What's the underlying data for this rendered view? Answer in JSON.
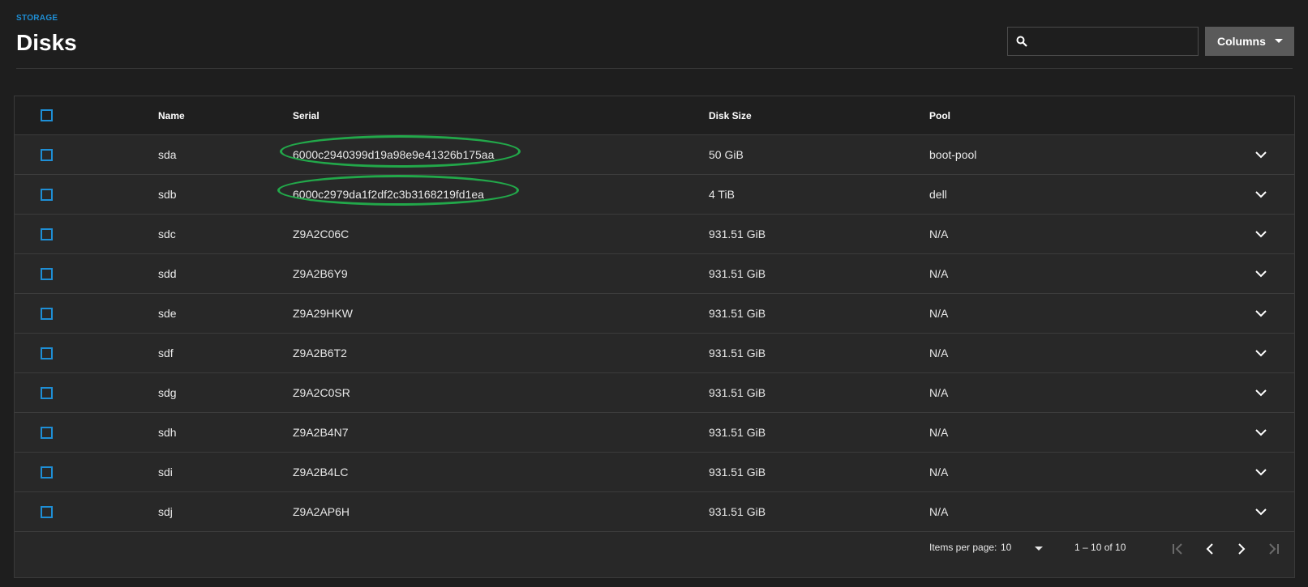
{
  "header": {
    "breadcrumb": "STORAGE",
    "title": "Disks",
    "search_placeholder": "",
    "columns_label": "Columns"
  },
  "table": {
    "columns": [
      "Name",
      "Serial",
      "Disk Size",
      "Pool"
    ],
    "rows": [
      {
        "name": "sda",
        "serial": "6000c2940399d19a98e9e41326b175aa",
        "size": "50 GiB",
        "pool": "boot-pool"
      },
      {
        "name": "sdb",
        "serial": "6000c2979da1f2df2c3b3168219fd1ea",
        "size": "4 TiB",
        "pool": "dell"
      },
      {
        "name": "sdc",
        "serial": "Z9A2C06C",
        "size": "931.51 GiB",
        "pool": "N/A"
      },
      {
        "name": "sdd",
        "serial": "Z9A2B6Y9",
        "size": "931.51 GiB",
        "pool": "N/A"
      },
      {
        "name": "sde",
        "serial": "Z9A29HKW",
        "size": "931.51 GiB",
        "pool": "N/A"
      },
      {
        "name": "sdf",
        "serial": "Z9A2B6T2",
        "size": "931.51 GiB",
        "pool": "N/A"
      },
      {
        "name": "sdg",
        "serial": "Z9A2C0SR",
        "size": "931.51 GiB",
        "pool": "N/A"
      },
      {
        "name": "sdh",
        "serial": "Z9A2B4N7",
        "size": "931.51 GiB",
        "pool": "N/A"
      },
      {
        "name": "sdi",
        "serial": "Z9A2B4LC",
        "size": "931.51 GiB",
        "pool": "N/A"
      },
      {
        "name": "sdj",
        "serial": "Z9A2AP6H",
        "size": "931.51 GiB",
        "pool": "N/A"
      }
    ]
  },
  "pagination": {
    "items_per_page_label": "Items per page:",
    "items_per_page_value": "10",
    "range_label": "1 – 10 of 10"
  },
  "icons": {
    "search": "search-icon",
    "expand": "chevron-down-icon",
    "first": "first-page-icon",
    "prev": "chevron-left-icon",
    "next": "chevron-right-icon",
    "last": "last-page-icon"
  },
  "colors": {
    "accent": "#1e8fd6",
    "highlight": "#22a84a",
    "background": "#1e1e1e",
    "card": "#282828"
  }
}
